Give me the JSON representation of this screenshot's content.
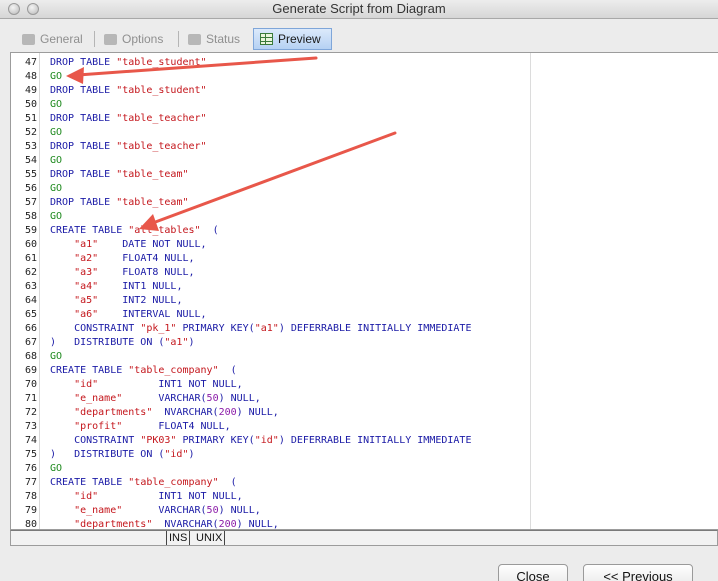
{
  "window": {
    "title": "Generate Script from Diagram"
  },
  "tabs": [
    {
      "label": "General",
      "active": false
    },
    {
      "label": "Options",
      "active": false
    },
    {
      "label": "Status",
      "active": false
    },
    {
      "label": "Preview",
      "active": true
    }
  ],
  "editor": {
    "lines": [
      {
        "n": "47",
        "html": "<span class='kw'>DROP TABLE </span><span class='str'>\"table_student\"</span>"
      },
      {
        "n": "48",
        "html": "<span class='go'>GO</span>"
      },
      {
        "n": "49",
        "html": "<span class='kw'>DROP TABLE </span><span class='str'>\"table_student\"</span>"
      },
      {
        "n": "50",
        "html": "<span class='go'>GO</span>"
      },
      {
        "n": "51",
        "html": "<span class='kw'>DROP TABLE </span><span class='str'>\"table_teacher\"</span>"
      },
      {
        "n": "52",
        "html": "<span class='go'>GO</span>"
      },
      {
        "n": "53",
        "html": "<span class='kw'>DROP TABLE </span><span class='str'>\"table_teacher\"</span>"
      },
      {
        "n": "54",
        "html": "<span class='go'>GO</span>"
      },
      {
        "n": "55",
        "html": "<span class='kw'>DROP TABLE </span><span class='str'>\"table_team\"</span>"
      },
      {
        "n": "56",
        "html": "<span class='go'>GO</span>"
      },
      {
        "n": "57",
        "html": "<span class='kw'>DROP TABLE </span><span class='str'>\"table_team\"</span>"
      },
      {
        "n": "58",
        "html": "<span class='go'>GO</span>"
      },
      {
        "n": "59",
        "html": "<span class='kw'>CREATE TABLE </span><span class='str'>\"all_tables\"</span><span class='plain'>  (</span>"
      },
      {
        "n": "60",
        "html": "<span class='str'>    \"a1\"</span><span class='kw'>    DATE NOT NULL,</span>"
      },
      {
        "n": "61",
        "html": "<span class='str'>    \"a2\"</span><span class='kw'>    FLOAT4 NULL,</span>"
      },
      {
        "n": "62",
        "html": "<span class='str'>    \"a3\"</span><span class='kw'>    FLOAT8 NULL,</span>"
      },
      {
        "n": "63",
        "html": "<span class='str'>    \"a4\"</span><span class='kw'>    INT1 NULL,</span>"
      },
      {
        "n": "64",
        "html": "<span class='str'>    \"a5\"</span><span class='kw'>    INT2 NULL,</span>"
      },
      {
        "n": "65",
        "html": "<span class='str'>    \"a6\"</span><span class='kw'>    INTERVAL NULL,</span>"
      },
      {
        "n": "66",
        "html": "<span class='kw'>    CONSTRAINT </span><span class='str'>\"pk_1\"</span><span class='kw'> PRIMARY KEY(</span><span class='str'>\"a1\"</span><span class='kw'>) DEFERRABLE INITIALLY IMMEDIATE</span>"
      },
      {
        "n": "67",
        "html": "<span class='kw'>)   DISTRIBUTE ON (</span><span class='str'>\"a1\"</span><span class='kw'>)</span>"
      },
      {
        "n": "68",
        "html": "<span class='go'>GO</span>"
      },
      {
        "n": "69",
        "html": "<span class='kw'>CREATE TABLE </span><span class='str'>\"table_company\"</span><span class='plain'>  (</span>"
      },
      {
        "n": "70",
        "html": "<span class='str'>    \"id\"          </span><span class='kw'>INT1 NOT NULL,</span>"
      },
      {
        "n": "71",
        "html": "<span class='str'>    \"e_name\"      </span><span class='kw'>VARCHAR(</span><span class='num'>50</span><span class='kw'>) NULL,</span>"
      },
      {
        "n": "72",
        "html": "<span class='str'>    \"departments\"  </span><span class='kw'>NVARCHAR(</span><span class='num'>200</span><span class='kw'>) NULL,</span>"
      },
      {
        "n": "73",
        "html": "<span class='str'>    \"profit\"      </span><span class='kw'>FLOAT4 NULL,</span>"
      },
      {
        "n": "74",
        "html": "<span class='kw'>    CONSTRAINT </span><span class='str'>\"PK03\"</span><span class='kw'> PRIMARY KEY(</span><span class='str'>\"id\"</span><span class='kw'>) DEFERRABLE INITIALLY IMMEDIATE</span>"
      },
      {
        "n": "75",
        "html": "<span class='kw'>)   DISTRIBUTE ON (</span><span class='str'>\"id\"</span><span class='kw'>)</span>"
      },
      {
        "n": "76",
        "html": "<span class='go'>GO</span>"
      },
      {
        "n": "77",
        "html": "<span class='kw'>CREATE TABLE </span><span class='str'>\"table_company\"</span><span class='plain'>  (</span>"
      },
      {
        "n": "78",
        "html": "<span class='str'>    \"id\"          </span><span class='kw'>INT1 NOT NULL,</span>"
      },
      {
        "n": "79",
        "html": "<span class='str'>    \"e_name\"      </span><span class='kw'>VARCHAR(</span><span class='num'>50</span><span class='kw'>) NULL,</span>"
      },
      {
        "n": "80",
        "html": "<span class='str'>    \"departments\"  </span><span class='kw'>NVARCHAR(</span><span class='num'>200</span><span class='kw'>) NULL,</span>"
      }
    ]
  },
  "statusbar": {
    "mode": "INS",
    "line_ending": "UNIX"
  },
  "buttons": {
    "close": "Close",
    "previous": "<< Previous"
  },
  "colors": {
    "keyword": "#1a1aa6",
    "string": "#c4161c",
    "number": "#8b1ba8",
    "go": "#1f8a1f",
    "annotation_arrow": "#e8574a",
    "active_tab": "#b5d1f3"
  }
}
